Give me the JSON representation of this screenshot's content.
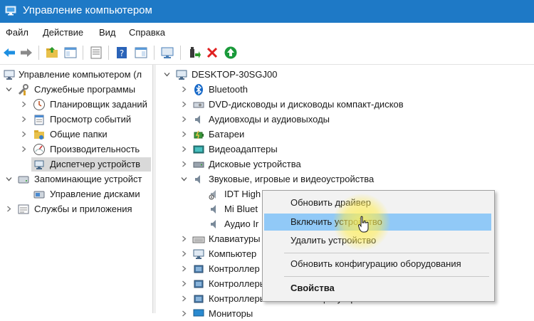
{
  "window": {
    "title": "Управление компьютером"
  },
  "menu": [
    "Файл",
    "Действие",
    "Вид",
    "Справка"
  ],
  "left_tree": [
    "Управление компьютером (л",
    "Служебные программы",
    "Планировщик заданий",
    "Просмотр событий",
    "Общие папки",
    "Производительность",
    "Диспетчер устройств",
    "Запоминающие устройст",
    "Управление дисками",
    "Службы и приложения"
  ],
  "device_tree": {
    "root": "DESKTOP-30SGJ00",
    "items": [
      "Bluetooth",
      "DVD-дисководы и дисководы компакт-дисков",
      "Аудиовходы и аудиовыходы",
      "Батареи",
      "Видеоадаптеры",
      "Дисковые устройства",
      "Звуковые, игровые и видеоустройства",
      "IDT High Definition Audio CODEC",
      "Mi Bluet",
      "Аудио Ir",
      "Клавиатуры",
      "Компьютер",
      "Контроллер",
      "Контроллеры",
      "Контроллеры запоминающих устройств",
      "Мониторы"
    ]
  },
  "context_menu": {
    "items": [
      "Обновить драйвер",
      "Включить устройство",
      "Удалить устройство",
      "Обновить конфигурацию оборудования",
      "Свойства"
    ],
    "highlighted": "Включить устройство"
  },
  "colors": {
    "titlebar": "#1e79c6",
    "highlight": "#91c9f7",
    "selection": "#d9d9d9"
  }
}
